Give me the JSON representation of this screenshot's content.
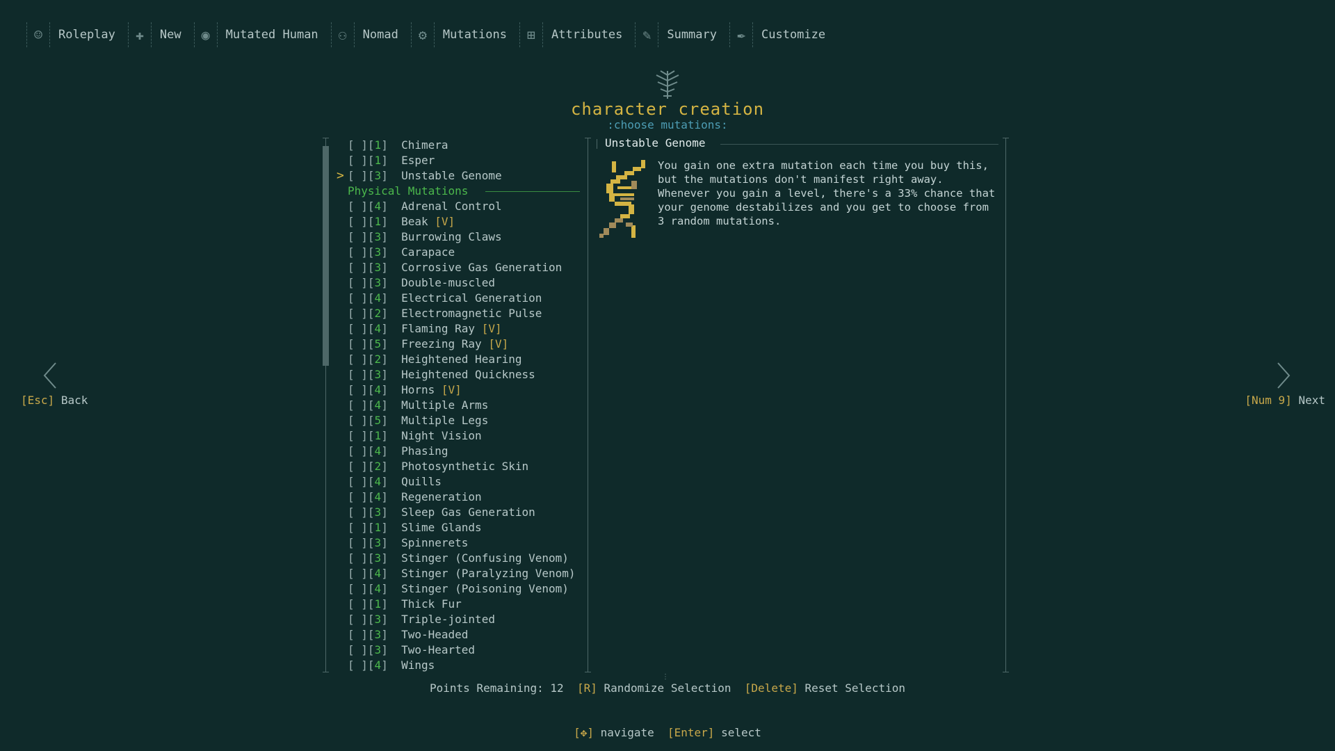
{
  "nav": [
    {
      "label": "Roleplay",
      "icon": "mask-icon"
    },
    {
      "label": "New",
      "icon": "plus-icon"
    },
    {
      "label": "Mutated Human",
      "icon": "head-icon"
    },
    {
      "label": "Nomad",
      "icon": "figure-icon"
    },
    {
      "label": "Mutations",
      "icon": "creature-icon"
    },
    {
      "label": "Attributes",
      "icon": "medkit-icon"
    },
    {
      "label": "Summary",
      "icon": "scroll-icon"
    },
    {
      "label": "Customize",
      "icon": "brush-icon"
    }
  ],
  "header": {
    "title": "character creation",
    "subtitle": ":choose mutations:"
  },
  "back": {
    "key": "[Esc]",
    "label": "Back"
  },
  "next": {
    "key": "[Num 9]",
    "label": "Next"
  },
  "mental_top": [
    {
      "cost": "1",
      "name": "Chimera"
    },
    {
      "cost": "1",
      "name": "Esper"
    },
    {
      "cost": "3",
      "name": "Unstable Genome"
    }
  ],
  "section": {
    "label": "Physical Mutations"
  },
  "physical": [
    {
      "cost": "4",
      "name": "Adrenal Control",
      "v": ""
    },
    {
      "cost": "1",
      "name": "Beak",
      "v": "[V]"
    },
    {
      "cost": "3",
      "name": "Burrowing Claws",
      "v": ""
    },
    {
      "cost": "3",
      "name": "Carapace",
      "v": ""
    },
    {
      "cost": "3",
      "name": "Corrosive Gas Generation",
      "v": ""
    },
    {
      "cost": "3",
      "name": "Double-muscled",
      "v": ""
    },
    {
      "cost": "4",
      "name": "Electrical Generation",
      "v": ""
    },
    {
      "cost": "2",
      "name": "Electromagnetic Pulse",
      "v": ""
    },
    {
      "cost": "4",
      "name": "Flaming Ray",
      "v": "[V]"
    },
    {
      "cost": "5",
      "name": "Freezing Ray",
      "v": "[V]"
    },
    {
      "cost": "2",
      "name": "Heightened Hearing",
      "v": ""
    },
    {
      "cost": "3",
      "name": "Heightened Quickness",
      "v": ""
    },
    {
      "cost": "4",
      "name": "Horns",
      "v": "[V]"
    },
    {
      "cost": "4",
      "name": "Multiple Arms",
      "v": ""
    },
    {
      "cost": "5",
      "name": "Multiple Legs",
      "v": ""
    },
    {
      "cost": "1",
      "name": "Night Vision",
      "v": ""
    },
    {
      "cost": "4",
      "name": "Phasing",
      "v": ""
    },
    {
      "cost": "2",
      "name": "Photosynthetic Skin",
      "v": ""
    },
    {
      "cost": "4",
      "name": "Quills",
      "v": ""
    },
    {
      "cost": "4",
      "name": "Regeneration",
      "v": ""
    },
    {
      "cost": "3",
      "name": "Sleep Gas Generation",
      "v": ""
    },
    {
      "cost": "1",
      "name": "Slime Glands",
      "v": ""
    },
    {
      "cost": "3",
      "name": "Spinnerets",
      "v": ""
    },
    {
      "cost": "3",
      "name": "Stinger (Confusing Venom)",
      "v": ""
    },
    {
      "cost": "4",
      "name": "Stinger (Paralyzing Venom)",
      "v": ""
    },
    {
      "cost": "4",
      "name": "Stinger (Poisoning Venom)",
      "v": ""
    },
    {
      "cost": "1",
      "name": "Thick Fur",
      "v": ""
    },
    {
      "cost": "3",
      "name": "Triple-jointed",
      "v": ""
    },
    {
      "cost": "3",
      "name": "Two-Headed",
      "v": ""
    },
    {
      "cost": "3",
      "name": "Two-Hearted",
      "v": ""
    },
    {
      "cost": "4",
      "name": "Wings",
      "v": ""
    }
  ],
  "description": {
    "title": "Unstable Genome",
    "text": "You gain one extra mutation each time you buy this, but the mutations don't manifest right away. Whenever you gain a level, there's a 33% chance that your genome destabilizes and you get to choose from 3 random mutations."
  },
  "footer": {
    "points_label": "Points Remaining:",
    "points_value": "12",
    "randomize_key": "[R]",
    "randomize_label": "Randomize Selection",
    "reset_key": "[Delete]",
    "reset_label": "Reset Selection"
  },
  "hints": {
    "navigate_key": "[",
    "navigate_key_end": "]",
    "navigate_label": "navigate",
    "select_key": "[Enter]",
    "select_label": "select"
  },
  "colors": {
    "background": "#0f2a2a",
    "accent_yellow": "#d4b443",
    "accent_green": "#4cb84c",
    "accent_blue": "#4d9db4"
  }
}
